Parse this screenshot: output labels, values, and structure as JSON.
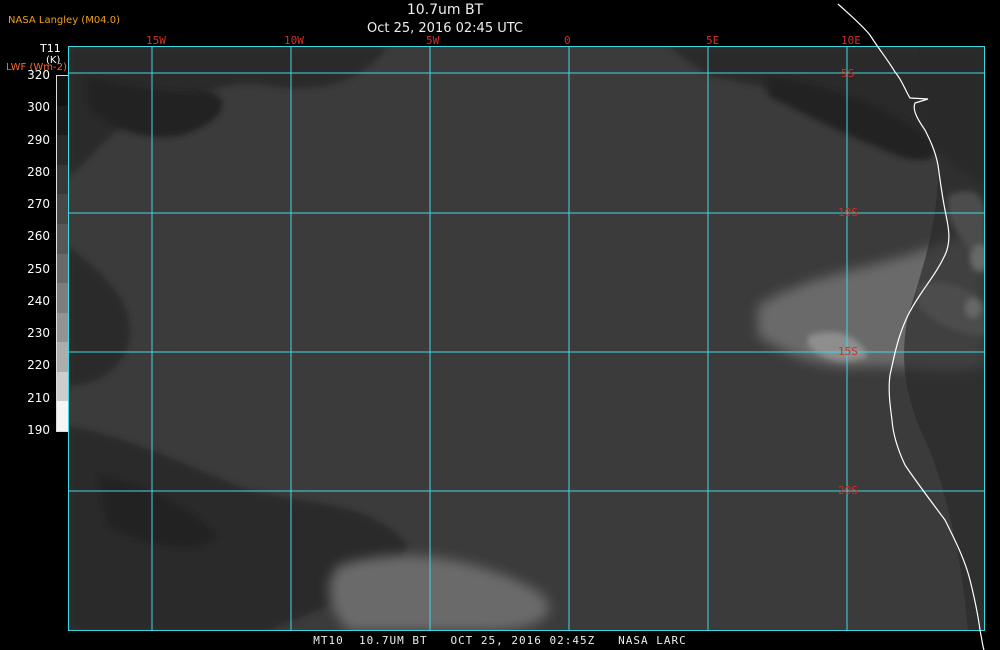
{
  "header": {
    "credit": "NASA Langley (M04.0)",
    "title": "10.7um BT",
    "subtitle": "Oct 25, 2016 02:45 UTC"
  },
  "legend": {
    "variable": "T11",
    "unit": "(K)",
    "secondary": "LWF (Wm-2)",
    "ticks": [
      "320",
      "300",
      "290",
      "280",
      "270",
      "260",
      "250",
      "240",
      "230",
      "220",
      "210",
      "190"
    ],
    "colors": [
      "#111111",
      "#1c1c1c",
      "#2a2a2a",
      "#383838",
      "#474747",
      "#575757",
      "#696969",
      "#7d7d7d",
      "#939393",
      "#adadad",
      "#cdcdcd",
      "#f5f5f5"
    ]
  },
  "map": {
    "longitude_labels": [
      "15W",
      "10W",
      "5W",
      "0",
      "5E",
      "10E"
    ],
    "latitude_labels": [
      "5S",
      "10S",
      "15S",
      "20S"
    ],
    "grid_color": "#40d8e0",
    "label_color": "#d43020",
    "coastline_color": "#ffffff"
  },
  "footer": {
    "text": "MT10  10.7UM BT   OCT 25, 2016 02:45Z   NASA LARC"
  }
}
